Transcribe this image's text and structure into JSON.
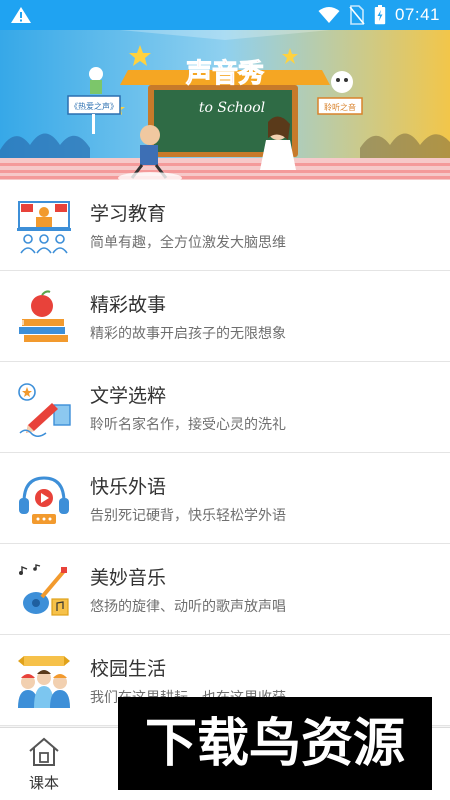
{
  "status_bar": {
    "time": "07:41"
  },
  "banner": {
    "logo_text": "声音秀",
    "board_text": "to School",
    "left_sign": "《热爱之声》",
    "right_sign": "聆听之音"
  },
  "list": {
    "items": [
      {
        "title": "学习教育",
        "subtitle": "简单有趣，全方位激发大脑思维",
        "icon": "classroom-icon"
      },
      {
        "title": "精彩故事",
        "subtitle": "精彩的故事开启孩子的无限想象",
        "icon": "books-apple-icon"
      },
      {
        "title": "文学选粹",
        "subtitle": "聆听名家名作，接受心灵的洗礼",
        "icon": "pen-writing-icon"
      },
      {
        "title": "快乐外语",
        "subtitle": "告别死记硬背，快乐轻松学外语",
        "icon": "headphones-icon"
      },
      {
        "title": "美妙音乐",
        "subtitle": "悠扬的旋律、动听的歌声放声唱",
        "icon": "guitar-icon"
      },
      {
        "title": "校园生活",
        "subtitle": "我们在这里耕耘，也在这里收获",
        "icon": "students-icon"
      }
    ]
  },
  "bottom_bar": {
    "tab_home_label": "课本"
  },
  "watermark": {
    "text": "下载鸟资源"
  },
  "colors": {
    "status_bar": "#1fa3f2",
    "accent_blue": "#3d8fd8",
    "accent_orange": "#f29a2e",
    "accent_red": "#e8423a"
  }
}
